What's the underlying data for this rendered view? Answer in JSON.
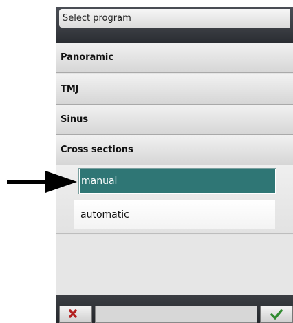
{
  "dialog": {
    "title": "Select program"
  },
  "menu": {
    "items": [
      {
        "label": "Panoramic"
      },
      {
        "label": "TMJ"
      },
      {
        "label": "Sinus"
      },
      {
        "label": "Cross sections"
      }
    ],
    "submenu": {
      "selected_label": "manual",
      "other_label": "automatic"
    }
  },
  "colors": {
    "selected_bg": "#2f7675",
    "cancel_icon": "#b32020",
    "ok_icon": "#2f8a2f",
    "arrow": "#000000"
  },
  "icons": {
    "cancel": "close-icon",
    "ok": "checkmark-icon",
    "annotation": "arrow-right-icon"
  }
}
